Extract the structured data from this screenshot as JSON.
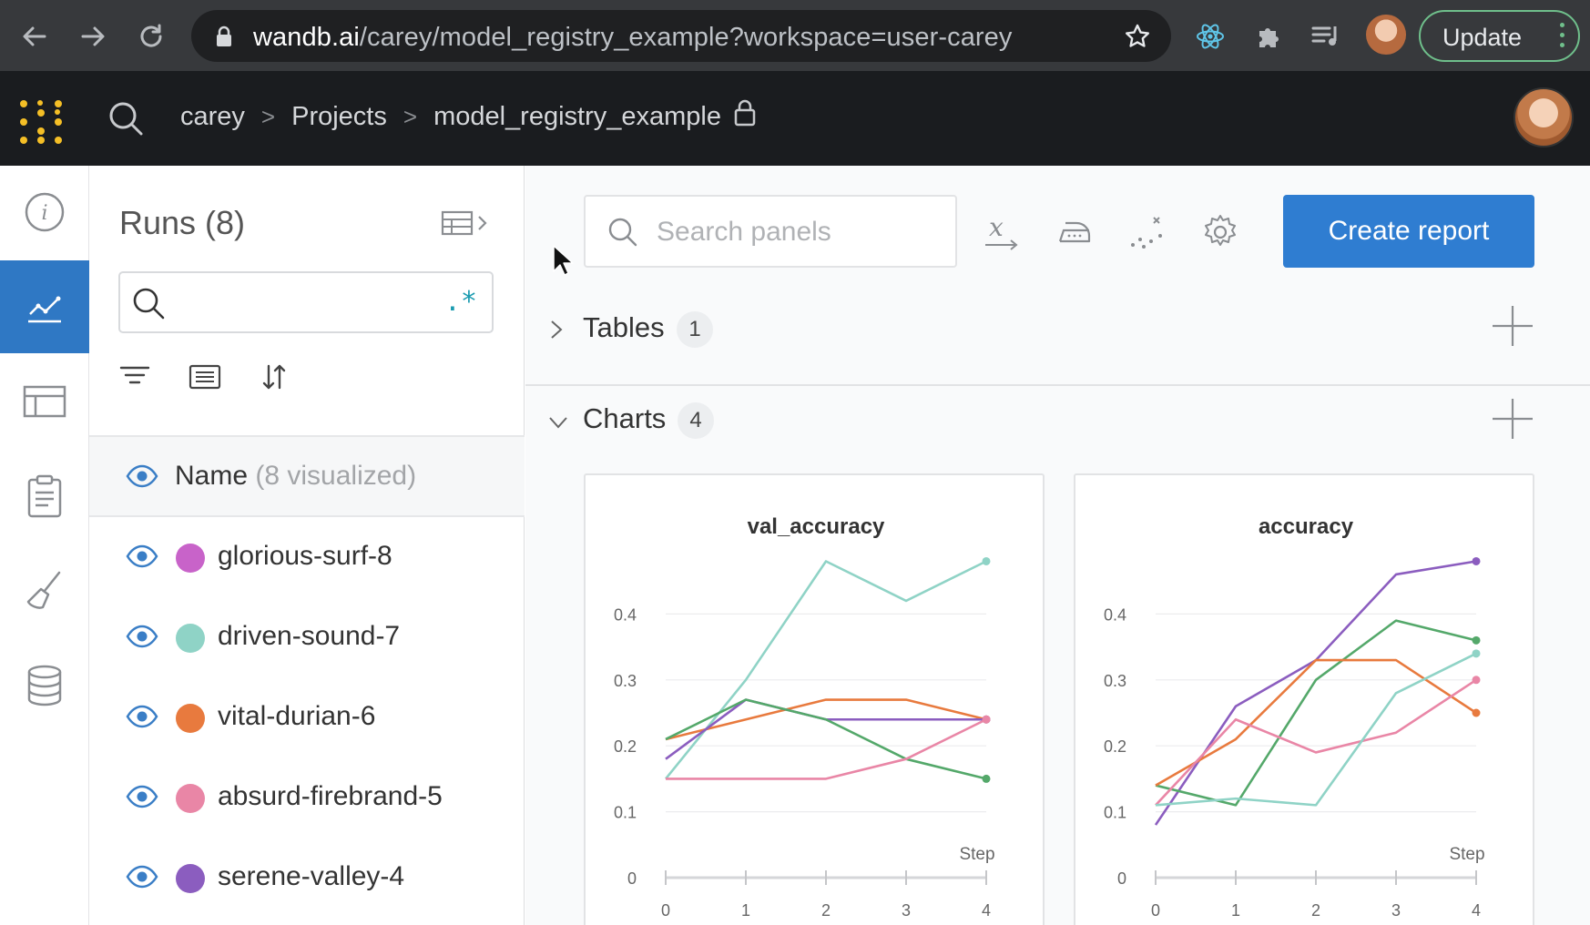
{
  "browser": {
    "url_host": "wandb.ai",
    "url_path": "/carey/model_registry_example?workspace=user-carey",
    "update_label": "Update"
  },
  "header": {
    "breadcrumbs": [
      "carey",
      "Projects",
      "model_registry_example"
    ],
    "breadcrumb_separator": ">"
  },
  "runs_panel": {
    "title": "Runs (8)",
    "search_value": "",
    "regex_toggle": ".*",
    "column_header": "Name",
    "column_header_sub": "(8 visualized)",
    "runs": [
      {
        "name": "glorious-surf-8",
        "color": "#c863c9"
      },
      {
        "name": "driven-sound-7",
        "color": "#8fd3c6"
      },
      {
        "name": "vital-durian-6",
        "color": "#e87a3e"
      },
      {
        "name": "absurd-firebrand-5",
        "color": "#e986a6"
      },
      {
        "name": "serene-valley-4",
        "color": "#8b5dbf"
      }
    ]
  },
  "workspace": {
    "search_placeholder": "Search panels",
    "create_report_label": "Create report",
    "sections": [
      {
        "name": "Tables",
        "count": "1",
        "expanded": false
      },
      {
        "name": "Charts",
        "count": "4",
        "expanded": true
      }
    ]
  },
  "chart_data": [
    {
      "type": "line",
      "title": "val_accuracy",
      "xlabel": "Step",
      "ylabel": "",
      "x": [
        0,
        1,
        2,
        3,
        4
      ],
      "xticks": [
        "0",
        "1",
        "2",
        "3",
        "4"
      ],
      "yticks": [
        "0",
        "0.1",
        "0.2",
        "0.3",
        "0.4"
      ],
      "ylim": [
        0,
        0.5
      ],
      "series": [
        {
          "color": "#8fd3c6",
          "values": [
            0.15,
            0.3,
            0.48,
            0.42,
            0.48
          ]
        },
        {
          "color": "#e87a3e",
          "values": [
            0.21,
            0.24,
            0.27,
            0.27,
            0.24
          ]
        },
        {
          "color": "#8b5dbf",
          "values": [
            0.18,
            0.27,
            0.24,
            0.24,
            0.24
          ]
        },
        {
          "color": "#54a86a",
          "values": [
            0.21,
            0.27,
            0.24,
            0.18,
            0.15
          ]
        },
        {
          "color": "#e986a6",
          "values": [
            0.15,
            0.15,
            0.15,
            0.18,
            0.24
          ]
        }
      ]
    },
    {
      "type": "line",
      "title": "accuracy",
      "xlabel": "Step",
      "ylabel": "",
      "x": [
        0,
        1,
        2,
        3,
        4
      ],
      "xticks": [
        "0",
        "1",
        "2",
        "3",
        "4"
      ],
      "yticks": [
        "0",
        "0.1",
        "0.2",
        "0.3",
        "0.4"
      ],
      "ylim": [
        0,
        0.5
      ],
      "series": [
        {
          "color": "#8b5dbf",
          "values": [
            0.08,
            0.26,
            0.33,
            0.46,
            0.48
          ]
        },
        {
          "color": "#54a86a",
          "values": [
            0.14,
            0.11,
            0.3,
            0.39,
            0.36
          ]
        },
        {
          "color": "#e87a3e",
          "values": [
            0.14,
            0.21,
            0.33,
            0.33,
            0.25
          ]
        },
        {
          "color": "#e986a6",
          "values": [
            0.11,
            0.24,
            0.19,
            0.22,
            0.3
          ]
        },
        {
          "color": "#8fd3c6",
          "values": [
            0.11,
            0.12,
            0.11,
            0.28,
            0.34
          ]
        }
      ]
    }
  ]
}
